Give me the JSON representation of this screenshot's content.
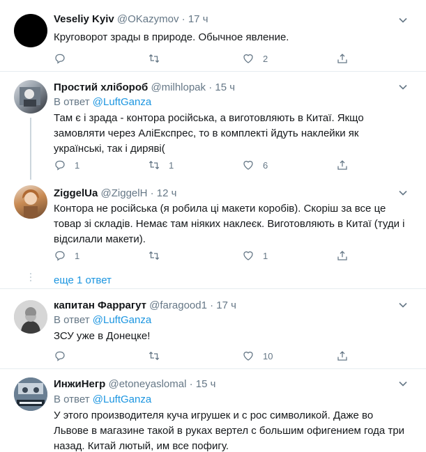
{
  "tweets": [
    {
      "name": "Veseliy Kyiv",
      "handle": "@OKazymov",
      "time": "17 ч",
      "text": "Круговорот зрады в природе. Обычное явление.",
      "replies": "",
      "retweets": "",
      "likes": "2"
    },
    {
      "name": "Простий хлібороб",
      "handle": "@milhlopak",
      "time": "15 ч",
      "reply_prefix": "В ответ",
      "reply_user": "@LuftGanza",
      "text": "Там є і зрада - контора російська, а виготовляють в Китаї. Якщо замовляти через АліЕкспрес, то в комплекті йдуть наклейки як українські, так і диряві(",
      "replies": "1",
      "retweets": "1",
      "likes": "6"
    },
    {
      "name": "ZiggelUa",
      "handle": "@ZiggelH",
      "time": "12 ч",
      "text": "Контора не російська (я робила ці макети коробів). Скоріш за все це товар зі складів. Немає там ніяких наклеєк. Виготовляють в Китаї (туди і відсилали макети).",
      "replies": "1",
      "retweets": "",
      "likes": "1",
      "more_replies": "еще 1 ответ"
    },
    {
      "name": "капитан Фаррагут",
      "handle": "@faragood1",
      "time": "17 ч",
      "reply_prefix": "В ответ",
      "reply_user": "@LuftGanza",
      "text": "ЗСУ уже в Донецке!",
      "replies": "",
      "retweets": "",
      "likes": "10"
    },
    {
      "name": "ИнжиНегр",
      "handle": "@etoneyaslomal",
      "time": "15 ч",
      "reply_prefix": "В ответ",
      "reply_user": "@LuftGanza",
      "text": "У этого производителя куча игрушек и с рос символикой. Даже во Львове в магазине такой в руках вертел с большим офигением года три назад. Китай лютый, им все пофигу."
    }
  ],
  "separator": "·",
  "icons": {
    "reply": "reply-icon",
    "retweet": "retweet-icon",
    "like": "heart-icon",
    "share": "share-icon",
    "more": "chevron-down-icon"
  },
  "colors": {
    "link": "#1b95e0",
    "secondary": "#657786",
    "border": "#e6ecf0"
  }
}
